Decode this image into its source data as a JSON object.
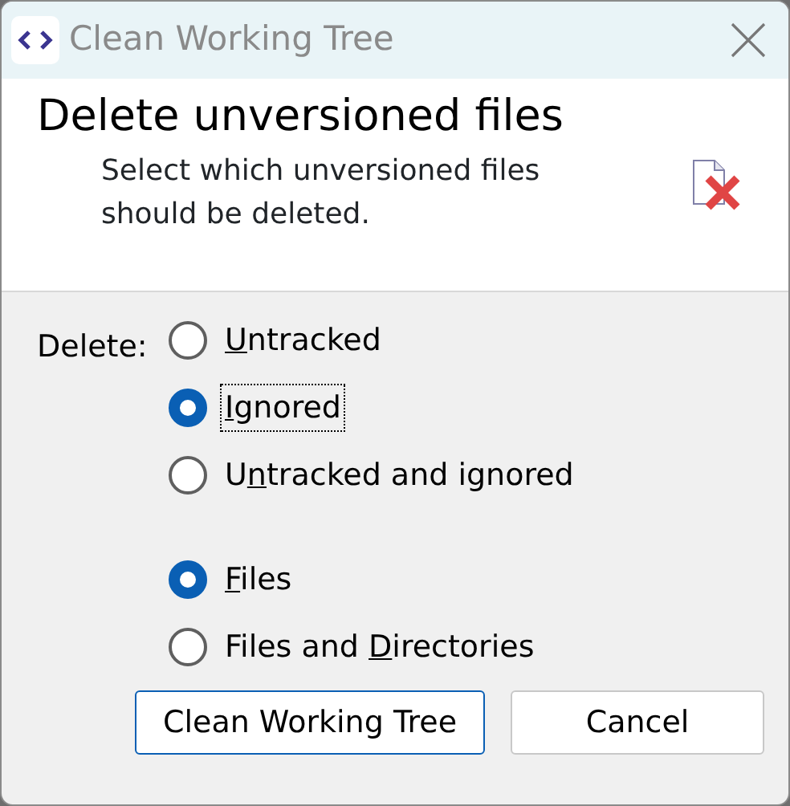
{
  "window": {
    "title": "Clean Working Tree"
  },
  "header": {
    "title": "Delete unversioned files",
    "description": "Select which unversioned files should be deleted."
  },
  "delete_label": "Delete:",
  "radio_groups": [
    {
      "options": [
        {
          "label_parts": [
            {
              "text": "U",
              "underlined": true
            },
            {
              "text": "ntracked",
              "underlined": false
            }
          ],
          "selected": false,
          "focused": false
        },
        {
          "label_parts": [
            {
              "text": "I",
              "underlined": true
            },
            {
              "text": "gnored",
              "underlined": false
            }
          ],
          "selected": true,
          "focused": true
        },
        {
          "label_parts": [
            {
              "text": "U",
              "underlined": false
            },
            {
              "text": "n",
              "underlined": true
            },
            {
              "text": "tracked and ignored",
              "underlined": false
            }
          ],
          "selected": false,
          "focused": false
        }
      ]
    },
    {
      "options": [
        {
          "label_parts": [
            {
              "text": "F",
              "underlined": true
            },
            {
              "text": "iles",
              "underlined": false
            }
          ],
          "selected": true,
          "focused": false
        },
        {
          "label_parts": [
            {
              "text": "Files and ",
              "underlined": false
            },
            {
              "text": "D",
              "underlined": true
            },
            {
              "text": "irectories",
              "underlined": false
            }
          ],
          "selected": false,
          "focused": false
        }
      ]
    }
  ],
  "buttons": [
    {
      "label": "Clean Working Tree",
      "default": true
    },
    {
      "label": "Cancel",
      "default": false
    }
  ]
}
